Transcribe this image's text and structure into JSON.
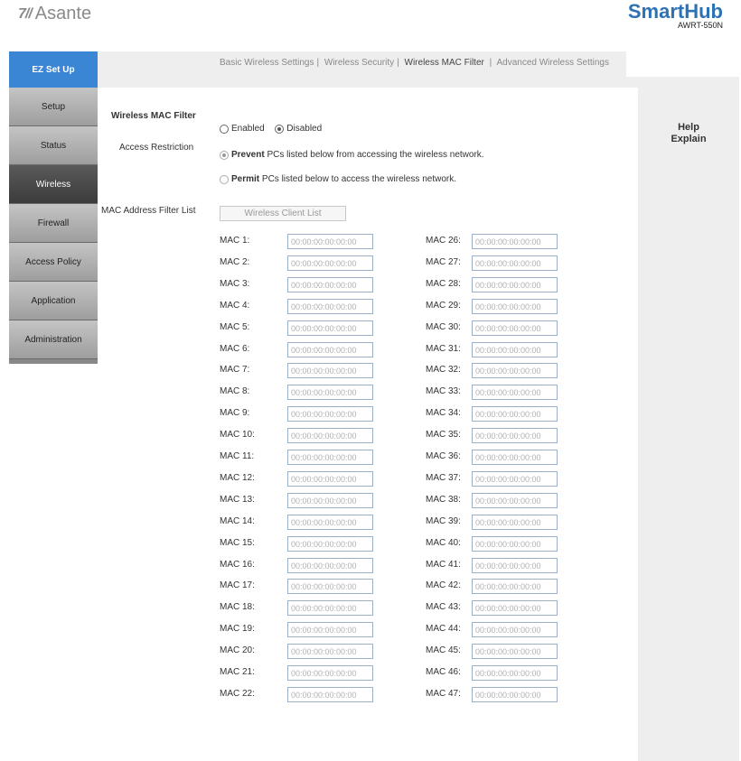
{
  "header": {
    "brand_left_mark": "7//",
    "brand_left_name": "Asante",
    "brand_right_name": "SmartHub",
    "brand_right_model": "AWRT-550N"
  },
  "topbar": {
    "ez_setup": "EZ Set Up",
    "subnav": [
      {
        "label": "Basic Wireless Settings",
        "active": false
      },
      {
        "label": "Wireless Security",
        "active": false
      },
      {
        "label": "Wireless MAC Filter",
        "active": true
      },
      {
        "label": "Advanced Wireless Settings",
        "active": false
      }
    ]
  },
  "sidebar": {
    "items": [
      "Setup",
      "Status",
      "Wireless",
      "Firewall",
      "Access Policy",
      "Application",
      "Administration"
    ],
    "active_index": 2
  },
  "help": {
    "line1": "Help",
    "line2": "Explain"
  },
  "form": {
    "mac_filter_label": "Wireless MAC Filter",
    "enabled_label": "Enabled",
    "disabled_label": "Disabled",
    "mac_filter_value": "Disabled",
    "access_restriction_label": "Access Restriction",
    "prevent_bold": "Prevent",
    "prevent_text": " PCs listed below from accessing the wireless network.",
    "permit_bold": "Permit",
    "permit_text": " PCs listed below to access the wireless network.",
    "access_restriction_value": "Prevent",
    "mac_list_label": "MAC Address Filter List",
    "wireless_client_button": "Wireless Client List"
  },
  "mac_rows": {
    "left": [
      {
        "label": "MAC 1:",
        "value": "00:00:00:00:00:00"
      },
      {
        "label": "MAC 2:",
        "value": "00:00:00:00:00:00"
      },
      {
        "label": "MAC 3:",
        "value": "00:00:00:00:00:00"
      },
      {
        "label": "MAC 4:",
        "value": "00:00:00:00:00:00"
      },
      {
        "label": "MAC 5:",
        "value": "00:00:00:00:00:00"
      },
      {
        "label": "MAC 6:",
        "value": "00:00:00:00:00:00"
      },
      {
        "label": "MAC 7:",
        "value": "00:00:00:00:00:00"
      },
      {
        "label": "MAC 8:",
        "value": "00:00:00:00:00:00"
      },
      {
        "label": "MAC 9:",
        "value": "00:00:00:00:00:00"
      },
      {
        "label": "MAC 10:",
        "value": "00:00:00:00:00:00"
      },
      {
        "label": "MAC 11:",
        "value": "00:00:00:00:00:00"
      },
      {
        "label": "MAC 12:",
        "value": "00:00:00:00:00:00"
      },
      {
        "label": "MAC 13:",
        "value": "00:00:00:00:00:00"
      },
      {
        "label": "MAC 14:",
        "value": "00:00:00:00:00:00"
      },
      {
        "label": "MAC 15:",
        "value": "00:00:00:00:00:00"
      },
      {
        "label": "MAC 16:",
        "value": "00:00:00:00:00:00"
      },
      {
        "label": "MAC 17:",
        "value": "00:00:00:00:00:00"
      },
      {
        "label": "MAC 18:",
        "value": "00:00:00:00:00:00"
      },
      {
        "label": "MAC 19:",
        "value": "00:00:00:00:00:00"
      },
      {
        "label": "MAC 20:",
        "value": "00:00:00:00:00:00"
      },
      {
        "label": "MAC 21:",
        "value": "00:00:00:00:00:00"
      },
      {
        "label": "MAC 22:",
        "value": "00:00:00:00:00:00"
      }
    ],
    "right": [
      {
        "label": "MAC 26:",
        "value": "00:00:00:00:00:00"
      },
      {
        "label": "MAC 27:",
        "value": "00:00:00:00:00:00"
      },
      {
        "label": "MAC 28:",
        "value": "00:00:00:00:00:00"
      },
      {
        "label": "MAC 29:",
        "value": "00:00:00:00:00:00"
      },
      {
        "label": "MAC 30:",
        "value": "00:00:00:00:00:00"
      },
      {
        "label": "MAC 31:",
        "value": "00:00:00:00:00:00"
      },
      {
        "label": "MAC 32:",
        "value": "00:00:00:00:00:00"
      },
      {
        "label": "MAC 33:",
        "value": "00:00:00:00:00:00"
      },
      {
        "label": "MAC 34:",
        "value": "00:00:00:00:00:00"
      },
      {
        "label": "MAC 35:",
        "value": "00:00:00:00:00:00"
      },
      {
        "label": "MAC 36:",
        "value": "00:00:00:00:00:00"
      },
      {
        "label": "MAC 37:",
        "value": "00:00:00:00:00:00"
      },
      {
        "label": "MAC 38:",
        "value": "00:00:00:00:00:00"
      },
      {
        "label": "MAC 39:",
        "value": "00:00:00:00:00:00"
      },
      {
        "label": "MAC 40:",
        "value": "00:00:00:00:00:00"
      },
      {
        "label": "MAC 41:",
        "value": "00:00:00:00:00:00"
      },
      {
        "label": "MAC 42:",
        "value": "00:00:00:00:00:00"
      },
      {
        "label": "MAC 43:",
        "value": "00:00:00:00:00:00"
      },
      {
        "label": "MAC 44:",
        "value": "00:00:00:00:00:00"
      },
      {
        "label": "MAC 45:",
        "value": "00:00:00:00:00:00"
      },
      {
        "label": "MAC 46:",
        "value": "00:00:00:00:00:00"
      },
      {
        "label": "MAC 47:",
        "value": "00:00:00:00:00:00"
      }
    ]
  },
  "colors": {
    "accent": "#3a86d4",
    "brand_blue": "#2c72b5",
    "sidebar_active": "#3b3b3b",
    "panel_gray": "#eeeeee"
  }
}
